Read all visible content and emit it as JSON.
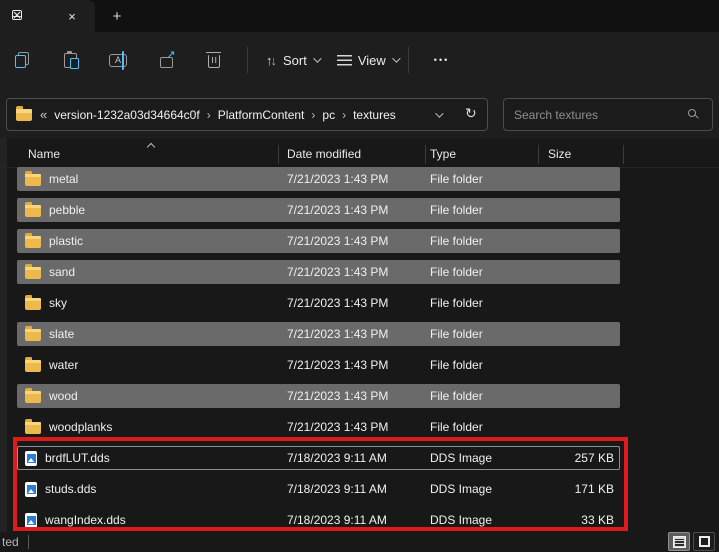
{
  "icons": {
    "close": "×",
    "minimize": "–",
    "plus": "+",
    "back_chevrons": "«",
    "crumb_separator": "›",
    "refresh": "↻",
    "share_arrow": "↗",
    "sort_up": "↑",
    "sort_down": "↓",
    "more": "•••",
    "rename_glyph": "A",
    "status_separator": "|"
  },
  "toolbar": {
    "sort_label": "Sort",
    "view_label": "View"
  },
  "addressbar": {
    "crumbs": [
      "version-1232a03d34664c0f",
      "PlatformContent",
      "pc",
      "textures"
    ]
  },
  "search": {
    "placeholder": "Search textures"
  },
  "list": {
    "columns": [
      "Name",
      "Date modified",
      "Type",
      "Size"
    ],
    "rows": [
      {
        "name": "metal",
        "date_modified": "7/21/2023 1:43 PM",
        "type": "File folder",
        "size": "",
        "icon": "folder",
        "selected": true,
        "focused": false
      },
      {
        "name": "pebble",
        "date_modified": "7/21/2023 1:43 PM",
        "type": "File folder",
        "size": "",
        "icon": "folder",
        "selected": true,
        "focused": false
      },
      {
        "name": "plastic",
        "date_modified": "7/21/2023 1:43 PM",
        "type": "File folder",
        "size": "",
        "icon": "folder",
        "selected": true,
        "focused": false
      },
      {
        "name": "sand",
        "date_modified": "7/21/2023 1:43 PM",
        "type": "File folder",
        "size": "",
        "icon": "folder",
        "selected": true,
        "focused": false
      },
      {
        "name": "sky",
        "date_modified": "7/21/2023 1:43 PM",
        "type": "File folder",
        "size": "",
        "icon": "folder",
        "selected": false,
        "focused": false
      },
      {
        "name": "slate",
        "date_modified": "7/21/2023 1:43 PM",
        "type": "File folder",
        "size": "",
        "icon": "folder",
        "selected": true,
        "focused": false
      },
      {
        "name": "water",
        "date_modified": "7/21/2023 1:43 PM",
        "type": "File folder",
        "size": "",
        "icon": "folder",
        "selected": false,
        "focused": false
      },
      {
        "name": "wood",
        "date_modified": "7/21/2023 1:43 PM",
        "type": "File folder",
        "size": "",
        "icon": "folder",
        "selected": true,
        "focused": false
      },
      {
        "name": "woodplanks",
        "date_modified": "7/21/2023 1:43 PM",
        "type": "File folder",
        "size": "",
        "icon": "folder",
        "selected": false,
        "focused": false
      },
      {
        "name": "brdfLUT.dds",
        "date_modified": "7/18/2023 9:11 AM",
        "type": "DDS Image",
        "size": "257 KB",
        "icon": "dds",
        "selected": false,
        "focused": true
      },
      {
        "name": "studs.dds",
        "date_modified": "7/18/2023 9:11 AM",
        "type": "DDS Image",
        "size": "171 KB",
        "icon": "dds",
        "selected": false,
        "focused": false
      },
      {
        "name": "wangIndex.dds",
        "date_modified": "7/18/2023 9:11 AM",
        "type": "DDS Image",
        "size": "33 KB",
        "icon": "dds",
        "selected": false,
        "focused": false
      }
    ]
  },
  "statusbar": {
    "left_text": "ted"
  },
  "colors": {
    "accent_blue": "#4cc2ff",
    "folder_yellow": "#edb94d",
    "selection_gray": "#6a6a6a",
    "annotation_red": "#de1b1b",
    "dds_icon_blue": "#2b7cd3"
  }
}
